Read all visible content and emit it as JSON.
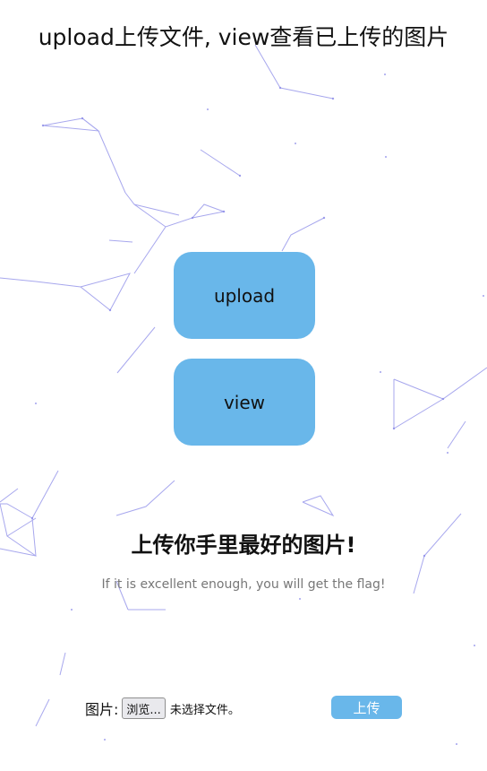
{
  "header": {
    "title": "upload上传文件, view查看已上传的图片"
  },
  "actions": {
    "upload_label": "upload",
    "view_label": "view"
  },
  "main": {
    "heading": "上传你手里最好的图片!",
    "subtitle": "If it is excellent enough, you will get the flag!"
  },
  "form": {
    "label": "图片:",
    "browse_label": "浏览...",
    "file_status": "未选择文件。",
    "submit_label": "上传"
  },
  "colors": {
    "button_bg": "#69b7ea",
    "background": "#ffffff",
    "particle_line": "#8a8ae8"
  }
}
